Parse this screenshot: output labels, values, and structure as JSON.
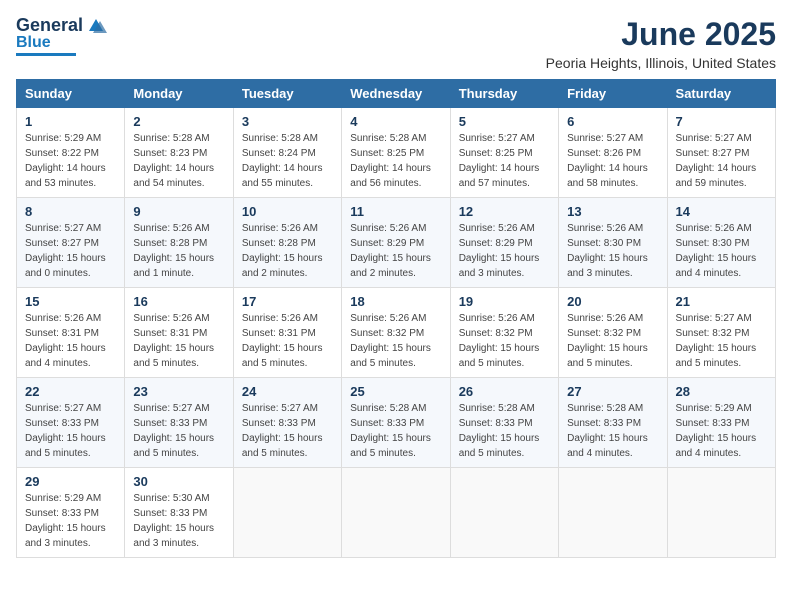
{
  "header": {
    "logo_line1": "General",
    "logo_line2": "Blue",
    "month_title": "June 2025",
    "location": "Peoria Heights, Illinois, United States"
  },
  "weekdays": [
    "Sunday",
    "Monday",
    "Tuesday",
    "Wednesday",
    "Thursday",
    "Friday",
    "Saturday"
  ],
  "weeks": [
    [
      {
        "day": 1,
        "sunrise": "5:29 AM",
        "sunset": "8:22 PM",
        "daylight": "14 hours and 53 minutes."
      },
      {
        "day": 2,
        "sunrise": "5:28 AM",
        "sunset": "8:23 PM",
        "daylight": "14 hours and 54 minutes."
      },
      {
        "day": 3,
        "sunrise": "5:28 AM",
        "sunset": "8:24 PM",
        "daylight": "14 hours and 55 minutes."
      },
      {
        "day": 4,
        "sunrise": "5:28 AM",
        "sunset": "8:25 PM",
        "daylight": "14 hours and 56 minutes."
      },
      {
        "day": 5,
        "sunrise": "5:27 AM",
        "sunset": "8:25 PM",
        "daylight": "14 hours and 57 minutes."
      },
      {
        "day": 6,
        "sunrise": "5:27 AM",
        "sunset": "8:26 PM",
        "daylight": "14 hours and 58 minutes."
      },
      {
        "day": 7,
        "sunrise": "5:27 AM",
        "sunset": "8:27 PM",
        "daylight": "14 hours and 59 minutes."
      }
    ],
    [
      {
        "day": 8,
        "sunrise": "5:27 AM",
        "sunset": "8:27 PM",
        "daylight": "15 hours and 0 minutes."
      },
      {
        "day": 9,
        "sunrise": "5:26 AM",
        "sunset": "8:28 PM",
        "daylight": "15 hours and 1 minute."
      },
      {
        "day": 10,
        "sunrise": "5:26 AM",
        "sunset": "8:28 PM",
        "daylight": "15 hours and 2 minutes."
      },
      {
        "day": 11,
        "sunrise": "5:26 AM",
        "sunset": "8:29 PM",
        "daylight": "15 hours and 2 minutes."
      },
      {
        "day": 12,
        "sunrise": "5:26 AM",
        "sunset": "8:29 PM",
        "daylight": "15 hours and 3 minutes."
      },
      {
        "day": 13,
        "sunrise": "5:26 AM",
        "sunset": "8:30 PM",
        "daylight": "15 hours and 3 minutes."
      },
      {
        "day": 14,
        "sunrise": "5:26 AM",
        "sunset": "8:30 PM",
        "daylight": "15 hours and 4 minutes."
      }
    ],
    [
      {
        "day": 15,
        "sunrise": "5:26 AM",
        "sunset": "8:31 PM",
        "daylight": "15 hours and 4 minutes."
      },
      {
        "day": 16,
        "sunrise": "5:26 AM",
        "sunset": "8:31 PM",
        "daylight": "15 hours and 5 minutes."
      },
      {
        "day": 17,
        "sunrise": "5:26 AM",
        "sunset": "8:31 PM",
        "daylight": "15 hours and 5 minutes."
      },
      {
        "day": 18,
        "sunrise": "5:26 AM",
        "sunset": "8:32 PM",
        "daylight": "15 hours and 5 minutes."
      },
      {
        "day": 19,
        "sunrise": "5:26 AM",
        "sunset": "8:32 PM",
        "daylight": "15 hours and 5 minutes."
      },
      {
        "day": 20,
        "sunrise": "5:26 AM",
        "sunset": "8:32 PM",
        "daylight": "15 hours and 5 minutes."
      },
      {
        "day": 21,
        "sunrise": "5:27 AM",
        "sunset": "8:32 PM",
        "daylight": "15 hours and 5 minutes."
      }
    ],
    [
      {
        "day": 22,
        "sunrise": "5:27 AM",
        "sunset": "8:33 PM",
        "daylight": "15 hours and 5 minutes."
      },
      {
        "day": 23,
        "sunrise": "5:27 AM",
        "sunset": "8:33 PM",
        "daylight": "15 hours and 5 minutes."
      },
      {
        "day": 24,
        "sunrise": "5:27 AM",
        "sunset": "8:33 PM",
        "daylight": "15 hours and 5 minutes."
      },
      {
        "day": 25,
        "sunrise": "5:28 AM",
        "sunset": "8:33 PM",
        "daylight": "15 hours and 5 minutes."
      },
      {
        "day": 26,
        "sunrise": "5:28 AM",
        "sunset": "8:33 PM",
        "daylight": "15 hours and 5 minutes."
      },
      {
        "day": 27,
        "sunrise": "5:28 AM",
        "sunset": "8:33 PM",
        "daylight": "15 hours and 4 minutes."
      },
      {
        "day": 28,
        "sunrise": "5:29 AM",
        "sunset": "8:33 PM",
        "daylight": "15 hours and 4 minutes."
      }
    ],
    [
      {
        "day": 29,
        "sunrise": "5:29 AM",
        "sunset": "8:33 PM",
        "daylight": "15 hours and 3 minutes."
      },
      {
        "day": 30,
        "sunrise": "5:30 AM",
        "sunset": "8:33 PM",
        "daylight": "15 hours and 3 minutes."
      },
      null,
      null,
      null,
      null,
      null
    ]
  ]
}
